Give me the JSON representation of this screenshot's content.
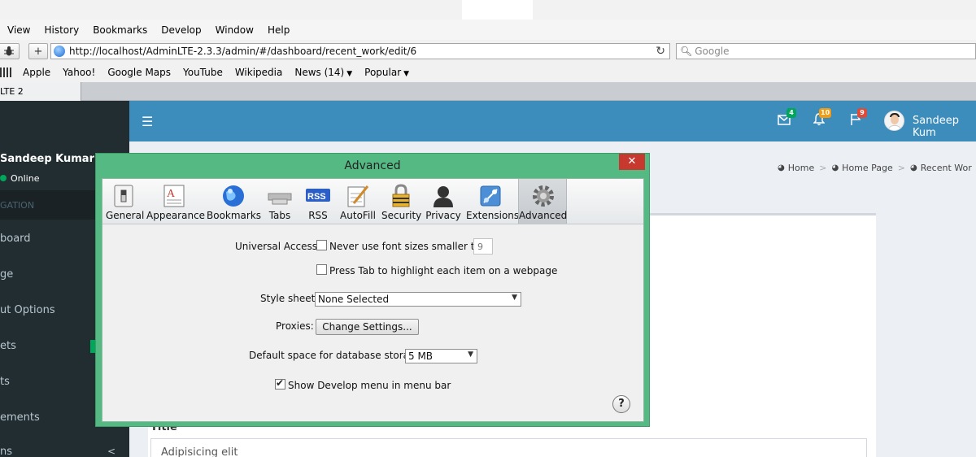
{
  "menubar": {
    "items": [
      "View",
      "History",
      "Bookmarks",
      "Develop",
      "Window",
      "Help"
    ]
  },
  "toolbar": {
    "url": "http://localhost/AdminLTE-2.3.3/admin/#/dashboard/recent_work/edit/6",
    "search_placeholder": "Google",
    "add_label": "+",
    "reload_label": "↻"
  },
  "bookmarks": {
    "items": [
      "Apple",
      "Yahoo!",
      "Google Maps",
      "YouTube",
      "Wikipedia"
    ],
    "news": "News (14)",
    "popular": "Popular"
  },
  "tab": {
    "title": "LTE 2"
  },
  "sidebar": {
    "user_name": "Sandeep Kumar",
    "status": "Online",
    "section_header": "GATION",
    "nav": [
      "board",
      "ge",
      "ut Options",
      "ets",
      "ts",
      "ements",
      "ns"
    ],
    "collapse_glyph": "<"
  },
  "header": {
    "mail_count": "4",
    "notification_count": "10",
    "flag_count": "9",
    "user_name": "Sandeep Kum",
    "badge_colors": {
      "mail": "#00a65a",
      "notifications": "#f39c12",
      "flags": "#dd4b39"
    }
  },
  "breadcrumb": {
    "items": [
      "Home",
      "Home Page",
      "Recent Wor"
    ]
  },
  "content": {
    "field_label": "Title",
    "field_value": "Adipisicing elit"
  },
  "dialog": {
    "title": "Advanced",
    "close_label": "✕",
    "tabs": [
      "General",
      "Appearance",
      "Bookmarks",
      "Tabs",
      "RSS",
      "AutoFill",
      "Security",
      "Privacy",
      "Extensions",
      "Advanced"
    ],
    "selected_tab": "Advanced",
    "universal_access_label": "Universal Access:",
    "min_font_label": "Never use font sizes smaller than",
    "min_font_value": "9",
    "tab_highlight_label": "Press Tab to highlight each item on a webpage",
    "stylesheet_label": "Style sheet:",
    "stylesheet_value": "None Selected",
    "proxies_label": "Proxies:",
    "change_settings_label": "Change Settings...",
    "db_storage_label": "Default space for database storage:",
    "db_storage_value": "5 MB",
    "show_develop_label": "Show Develop menu in menu bar",
    "help_label": "?"
  }
}
